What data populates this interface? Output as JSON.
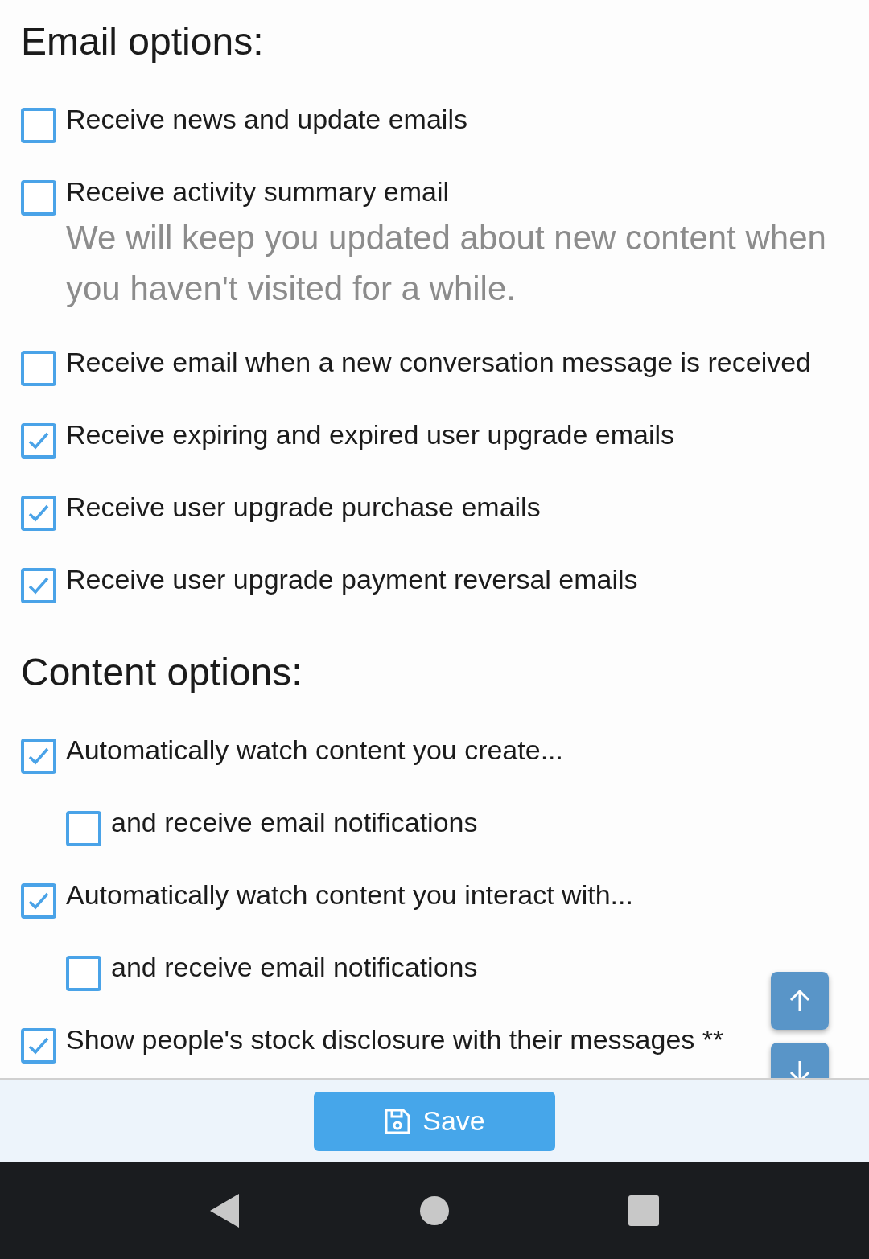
{
  "sections": [
    {
      "title": "Email options:",
      "items": [
        {
          "kind": "option",
          "label": "Receive news and update emails",
          "checked": false
        },
        {
          "kind": "option",
          "label": "Receive activity summary email",
          "checked": false,
          "hint": "We will keep you updated about new content when you haven't visited for a while."
        },
        {
          "kind": "option",
          "label": "Receive email when a new conversation message is received",
          "checked": false
        },
        {
          "kind": "option",
          "label": "Receive expiring and expired user upgrade emails",
          "checked": true
        },
        {
          "kind": "option",
          "label": "Receive user upgrade purchase emails",
          "checked": true
        },
        {
          "kind": "option",
          "label": "Receive user upgrade payment reversal emails",
          "checked": true
        }
      ]
    },
    {
      "title": "Content options:",
      "items": [
        {
          "kind": "option",
          "label": "Automatically watch content you create...",
          "checked": true
        },
        {
          "kind": "sub",
          "label": "and receive email notifications",
          "checked": false
        },
        {
          "kind": "option",
          "label": "Automatically watch content you interact with...",
          "checked": true
        },
        {
          "kind": "sub",
          "label": "and receive email notifications",
          "checked": false
        },
        {
          "kind": "option",
          "label": "Show people's stock disclosure with their messages **",
          "checked": true
        }
      ]
    }
  ],
  "save_button": {
    "label": "Save"
  }
}
